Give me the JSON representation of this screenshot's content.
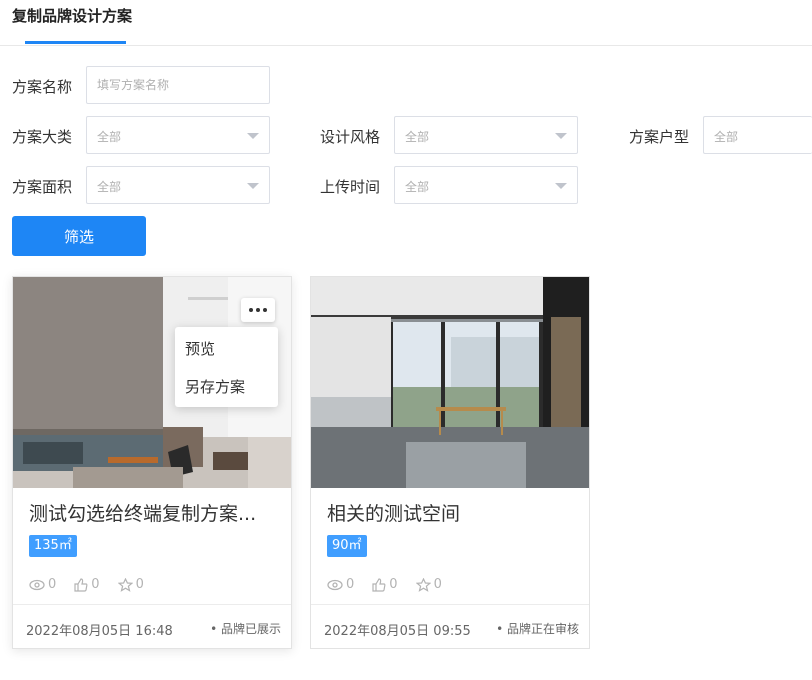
{
  "header": {
    "tab_label": "复制品牌设计方案"
  },
  "filters": {
    "name_label": "方案名称",
    "name_placeholder": "填写方案名称",
    "category_label": "方案大类",
    "category_value": "全部",
    "style_label": "设计风格",
    "style_value": "全部",
    "layout_label": "方案户型",
    "layout_value": "全部",
    "size_label": "方案面积",
    "size_value": "全部",
    "upload_label": "上传时间",
    "upload_value": "全部",
    "submit_label": "筛选"
  },
  "cards": [
    {
      "title": "测试勾选给终端复制方案...",
      "area": "135㎡",
      "views": "0",
      "likes": "0",
      "favorites": "0",
      "date": "2022年08月05日 16:48",
      "status": "• 品牌已展示",
      "menu": {
        "preview": "预览",
        "save_as": "另存方案"
      }
    },
    {
      "title": "相关的测试空间",
      "area": "90㎡",
      "views": "0",
      "likes": "0",
      "favorites": "0",
      "date": "2022年08月05日 09:55",
      "status": "• 品牌正在审核"
    }
  ],
  "colors": {
    "accent": "#1e86f5",
    "tag": "#409eff"
  }
}
